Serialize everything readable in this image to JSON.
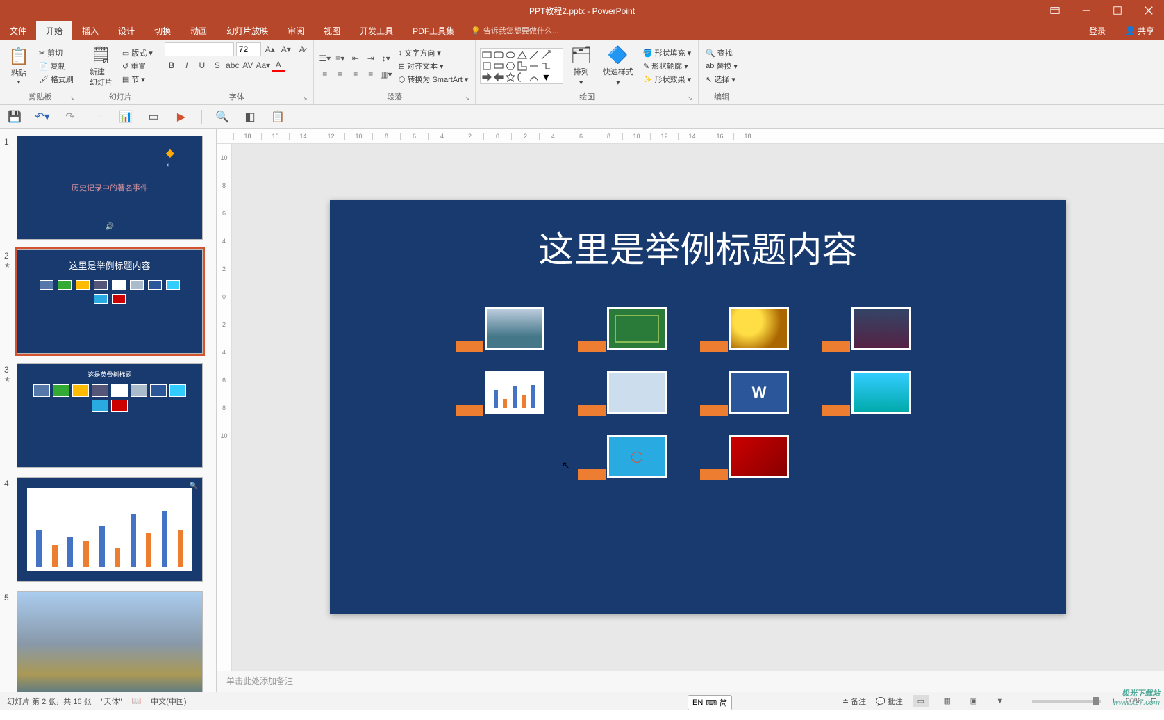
{
  "title": "PPT教程2.pptx - PowerPoint",
  "menu": {
    "file": "文件",
    "tabs": [
      "开始",
      "插入",
      "设计",
      "切换",
      "动画",
      "幻灯片放映",
      "审阅",
      "视图",
      "开发工具",
      "PDF工具集"
    ],
    "active": "开始",
    "tell_me": "告诉我您想要做什么...",
    "login": "登录",
    "share": "共享"
  },
  "ribbon": {
    "clipboard": {
      "paste": "粘贴",
      "cut": "剪切",
      "copy": "复制",
      "format_painter": "格式刷",
      "label": "剪贴板"
    },
    "slides": {
      "new_slide": "新建\n幻灯片",
      "layout": "版式",
      "reset": "重置",
      "section": "节",
      "label": "幻灯片"
    },
    "font": {
      "size": "72",
      "label": "字体"
    },
    "paragraph": {
      "text_dir": "文字方向",
      "align_text": "对齐文本",
      "smartart": "转换为 SmartArt",
      "label": "段落"
    },
    "drawing": {
      "arrange": "排列",
      "quick_styles": "快速样式",
      "shape_fill": "形状填充",
      "shape_outline": "形状轮廓",
      "shape_effects": "形状效果",
      "label": "绘图"
    },
    "editing": {
      "find": "查找",
      "replace": "替换",
      "select": "选择",
      "label": "编辑"
    }
  },
  "slide_content": {
    "title": "这里是举例标题内容",
    "thumb1_title": "历史记录中的著名事件",
    "thumb2_title": "这里是举例标题内容",
    "thumb3_title": "这是英骨树标题",
    "word_icon": "W"
  },
  "notes_placeholder": "单击此处添加备注",
  "status": {
    "slide_info": "幻灯片 第 2 张，共 16 张",
    "theme": "\"天体\"",
    "lang": "中文(中国)",
    "notes_btn": "备注",
    "comments_btn": "批注",
    "zoom": "90%"
  },
  "ime": {
    "en": "EN",
    "pin": "简"
  },
  "watermark": {
    "l1": "极光下载站",
    "l2": "www.xz7.com"
  },
  "ruler_marks": [
    "18",
    "16",
    "14",
    "12",
    "10",
    "8",
    "6",
    "4",
    "2",
    "0",
    "2",
    "4",
    "6",
    "8",
    "10",
    "12",
    "14",
    "16",
    "18"
  ],
  "ruler_v": [
    "10",
    "8",
    "6",
    "4",
    "2",
    "0",
    "2",
    "4",
    "6",
    "8",
    "10"
  ]
}
